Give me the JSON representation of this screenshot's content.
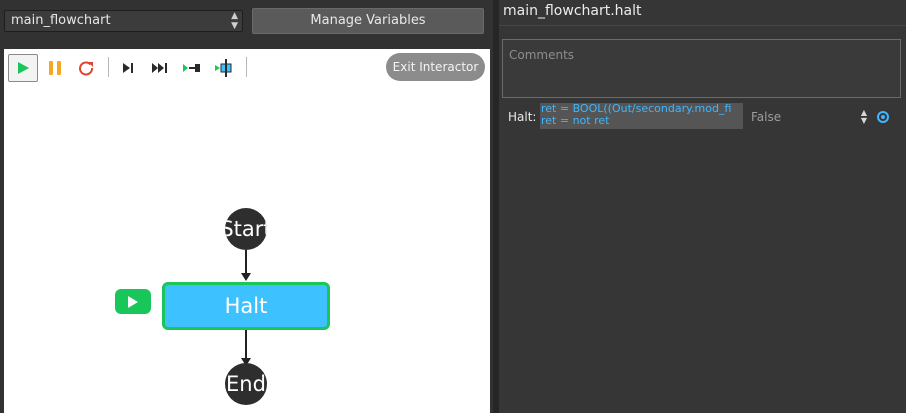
{
  "toolbar_top": {
    "flowchart_select": "main_flowchart",
    "manage_variables_label": "Manage Variables"
  },
  "canvas": {
    "tools": [
      "play-icon",
      "pause-icon",
      "restart-icon",
      "step-icon",
      "fast-forward-icon",
      "run-to-icon",
      "breakpoint-icon"
    ],
    "exit_label": "Exit Interactor",
    "nodes": {
      "start": "Start",
      "halt": "Halt",
      "end": "End"
    },
    "colors": {
      "halt_fill": "#3ec1ff",
      "active_border": "#19c65a",
      "terminal_fill": "#2e2e2e"
    }
  },
  "right_panel": {
    "title": "main_flowchart.halt",
    "comments_placeholder": "Comments",
    "halt_label": "Halt:",
    "code_lines": [
      "ret = BOOL((Out/secondary.mod_fi",
      "ret = not ret"
    ],
    "halt_select_value": "False",
    "accent_color": "#3fb6ff"
  }
}
